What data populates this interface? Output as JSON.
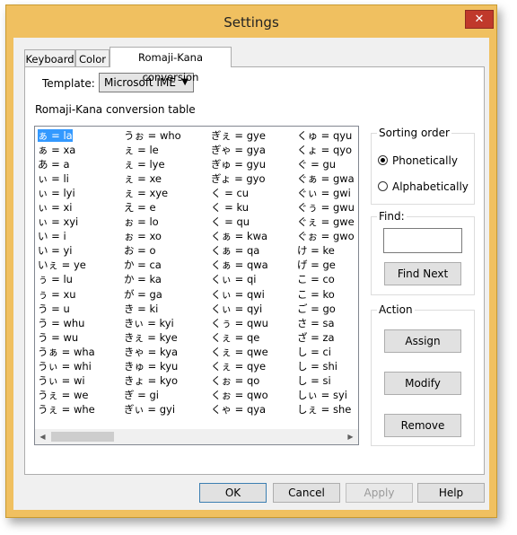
{
  "window": {
    "title": "Settings",
    "close_glyph": "✕"
  },
  "tabs": [
    {
      "label": "Keyboard"
    },
    {
      "label": "Color"
    },
    {
      "label": "Romaji-Kana conversion",
      "active": true
    }
  ],
  "template": {
    "label": "Template:",
    "value": "Microsoft IME",
    "arrow": "▼"
  },
  "table_label": "Romaji-Kana conversion table",
  "columns": [
    [
      "ぁ = la",
      "ぁ = xa",
      "あ = a",
      "ぃ = li",
      "ぃ = lyi",
      "ぃ = xi",
      "ぃ = xyi",
      "い = i",
      "い = yi",
      "いぇ = ye",
      "ぅ = lu",
      "ぅ = xu",
      "う = u",
      "う = whu",
      "う = wu",
      "うぁ = wha",
      "うぃ = whi",
      "うぃ = wi",
      "うぇ = we",
      "うぇ = whe"
    ],
    [
      "うぉ = who",
      "ぇ = le",
      "ぇ = lye",
      "ぇ = xe",
      "ぇ = xye",
      "え = e",
      "ぉ = lo",
      "ぉ = xo",
      "お = o",
      "か = ca",
      "か = ka",
      "が = ga",
      "き = ki",
      "きぃ = kyi",
      "きぇ = kye",
      "きゃ = kya",
      "きゅ = kyu",
      "きょ = kyo",
      "ぎ = gi",
      "ぎぃ = gyi"
    ],
    [
      "ぎぇ = gye",
      "ぎゃ = gya",
      "ぎゅ = gyu",
      "ぎょ = gyo",
      "く = cu",
      "く = ku",
      "く = qu",
      "くぁ = kwa",
      "くぁ = qa",
      "くぁ = qwa",
      "くぃ = qi",
      "くぃ = qwi",
      "くぃ = qyi",
      "くぅ = qwu",
      "くぇ = qe",
      "くぇ = qwe",
      "くぇ = qye",
      "くぉ = qo",
      "くぉ = qwo",
      "くゃ = qya"
    ],
    [
      "くゅ = qyu",
      "くょ = qyo",
      "ぐ = gu",
      "ぐぁ = gwa",
      "ぐぃ = gwi",
      "ぐぅ = gwu",
      "ぐぇ = gwe",
      "ぐぉ = gwo",
      "け = ke",
      "げ = ge",
      "こ = co",
      "こ = ko",
      "ご = go",
      "さ = sa",
      "ざ = za",
      "し = ci",
      "し = shi",
      "し = si",
      "しぃ = syi",
      "しぇ = she"
    ]
  ],
  "sorting": {
    "legend": "Sorting order",
    "options": [
      {
        "label": "Phonetically",
        "selected": true
      },
      {
        "label": "Alphabetically",
        "selected": false
      }
    ]
  },
  "find": {
    "legend": "Find:",
    "value": "",
    "button": "Find Next"
  },
  "action": {
    "legend": "Action",
    "assign": "Assign",
    "modify": "Modify",
    "remove": "Remove"
  },
  "footer": {
    "ok": "OK",
    "cancel": "Cancel",
    "apply": "Apply",
    "help": "Help"
  },
  "scroll": {
    "left": "◀",
    "right": "▶"
  }
}
